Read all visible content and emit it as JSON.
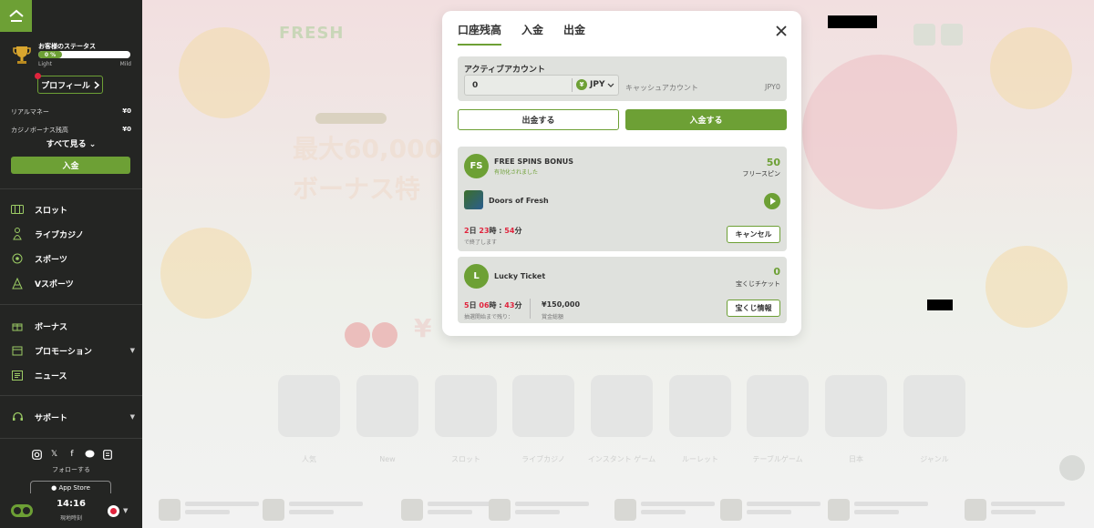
{
  "sidebar": {
    "status_title": "お客様のステータス",
    "progress_percent": 0,
    "progress_label": "0 %",
    "level_from": "Light",
    "level_to": "Mild",
    "profile_label": "プロフィール",
    "balances": [
      {
        "label": "リアルマネー",
        "value": "¥0"
      },
      {
        "label": "カジノボーナス残高",
        "value": "¥0"
      }
    ],
    "see_all": "すべて見る",
    "deposit": "入金",
    "nav": [
      {
        "label": "スロット",
        "icon": "slot-icon"
      },
      {
        "label": "ライブカジノ",
        "icon": "live-casino-icon"
      },
      {
        "label": "スポーツ",
        "icon": "sports-icon"
      },
      {
        "label": "Vスポーツ",
        "icon": "vsports-icon"
      },
      {
        "label": "ボーナス",
        "icon": "gift-icon"
      },
      {
        "label": "プロモーション",
        "icon": "promotion-icon"
      },
      {
        "label": "ニュース",
        "icon": "news-icon"
      },
      {
        "label": "サポート",
        "icon": "support-icon"
      }
    ],
    "follow": "フォローする",
    "app_store": "App Store",
    "time": "14:16",
    "time_sub": "現地時刻"
  },
  "background": {
    "logo": "FRESH",
    "promo_line1": "最大60,000",
    "promo_line2": "ボーナス特",
    "yen": "¥",
    "categories": [
      "人気",
      "New",
      "スロット",
      "ライブカジノ",
      "インスタント ゲーム",
      "ルーレット",
      "テーブルゲーム",
      "日本",
      "ジャンル"
    ]
  },
  "modal": {
    "tabs": [
      "口座残高",
      "入金",
      "出金"
    ],
    "active_account_label": "アクティブアカウント",
    "amount": "0",
    "currency": "JPY",
    "cash_account_label": "キャッシュアカウント",
    "cash_account_value": "JPY0",
    "withdraw_button": "出金する",
    "deposit_button": "入金する",
    "free_spins": {
      "badge": "FS",
      "title": "FREE SPINS BONUS",
      "subtitle": "有効化されました",
      "count": "50",
      "unit": "フリースピン",
      "game": "Doors of Fresh",
      "timer_days": "2",
      "timer_days_unit": "日",
      "timer_hours": "23",
      "timer_hours_unit": "時",
      "timer_minutes": "54",
      "timer_minutes_unit": "分",
      "timer_note": "で終了します",
      "cancel_button": "キャンセル"
    },
    "lucky_ticket": {
      "badge": "L",
      "title": "Lucky Ticket",
      "count": "0",
      "unit": "宝くじチケット",
      "timer_days": "5",
      "timer_days_unit": "日",
      "timer_hours": "06",
      "timer_hours_unit": "時",
      "timer_minutes": "43",
      "timer_minutes_unit": "分",
      "timer_note": "抽選開始まで残り：",
      "prize": "¥150,000",
      "prize_label": "賞金総額",
      "info_button": "宝くじ情報"
    }
  }
}
